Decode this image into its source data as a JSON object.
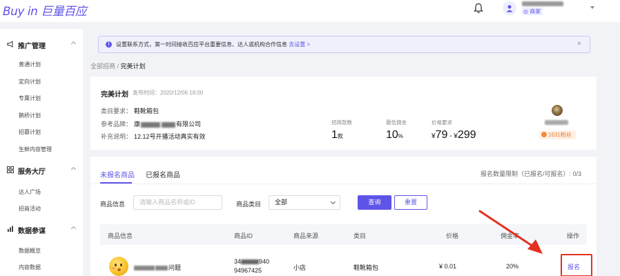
{
  "header": {
    "logo": "Buy in 巨量百应",
    "store_badge": "◎ 商家"
  },
  "sidebar": {
    "groups": [
      {
        "label": "推广管理",
        "items": [
          "普通计划",
          "定向计划",
          "专属计划",
          "鹊桥计划",
          "招募计划",
          "生鲜内容管理"
        ]
      },
      {
        "label": "服务大厅",
        "items": [
          "达人广场",
          "招商活动"
        ]
      },
      {
        "label": "数据参谋",
        "items": [
          "数据概览",
          "内容数据"
        ]
      }
    ]
  },
  "notice": {
    "text": "设置联系方式，第一时间接收百应平台重要信息、达人或机构合作信息",
    "link": "去设置 >",
    "close": "×"
  },
  "breadcrumb": {
    "root": "全部招商",
    "sep": " / ",
    "current": "完美计划"
  },
  "plan": {
    "title": "完美计划",
    "published": "发布时间：2020/12/06 18:00",
    "category_label": "类目要求：",
    "category_value": "鞋靴箱包",
    "brand_label": "参考品牌：",
    "brand_prefix": "康",
    "brand_suffix": "有限公司",
    "note_label": "补充说明：",
    "note_value": "12.12号开播活动真实有效",
    "stats": [
      {
        "label": "招商款数",
        "value": "1",
        "unit": "款"
      },
      {
        "label": "最低佣金",
        "value": "10",
        "unit": "%"
      },
      {
        "label": "价格要求",
        "prefix": "¥",
        "min": "79",
        "sep": " - ",
        "prefix2": "¥",
        "max": "299"
      }
    ],
    "fans": "1631粉丝"
  },
  "list": {
    "tabs": [
      "未报名商品",
      "已报名商品"
    ],
    "limit": "报名数量限制（已报名/可报名）: 0/3",
    "filters": {
      "product_label": "商品信息",
      "product_placeholder": "请输入商品名称或ID",
      "category_label": "商品类目",
      "category_value": "全部",
      "query_button": "查询",
      "reset_button": "重置"
    },
    "columns": [
      "商品信息",
      "商品ID",
      "商品来源",
      "类目",
      "价格",
      "佣金率",
      "操作"
    ],
    "rows": [
      {
        "name_suffix": "问题",
        "id_prefix": "34",
        "id_suffix": "940",
        "id_line2": "94967425",
        "source": "小店",
        "category": "鞋靴箱包",
        "price": "¥ 0.01",
        "commission": "20%",
        "action": "报名"
      }
    ]
  }
}
